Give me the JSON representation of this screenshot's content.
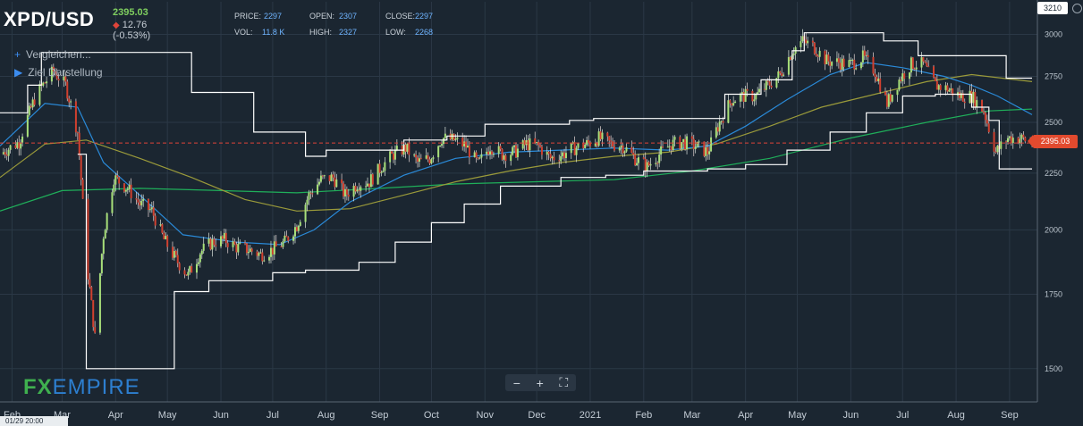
{
  "header": {
    "symbol": "XPD/USD",
    "last_price": "2395.03",
    "change": "12.76 (-0.53%)",
    "change_direction": "down"
  },
  "stats": {
    "price_label": "PRICE:",
    "price_value": "2297",
    "open_label": "OPEN:",
    "open_value": "2307",
    "close_label": "CLOSE:",
    "close_value": "2297",
    "vol_label": "VOL:",
    "vol_value": "11.8 K",
    "high_label": "HIGH:",
    "high_value": "2327",
    "low_label": "LOW:",
    "low_value": "2268"
  },
  "side_menu": {
    "compare_label": "Vergleichen...",
    "target_label": "Ziel Darstellung"
  },
  "logo": {
    "part1": "FX",
    "part2": "EMPIRE"
  },
  "zoom": {
    "minus": "−",
    "plus": "+",
    "fit": "⛶"
  },
  "axis_badges": {
    "top_value": "3210",
    "last_value": "2395.03"
  },
  "cursor": {
    "timestamp": "01/29 20:00"
  },
  "colors": {
    "background": "#1b2631",
    "up_candle": "#a8e07a",
    "down_candle": "#d0402f",
    "ma_fast": "#2a8ad8",
    "ma_slow": "#9a9a3a",
    "ma_long": "#1faf5a",
    "channel": "#ffffff",
    "last_line": "#e0443a"
  },
  "chart_data": {
    "type": "line",
    "title": "XPD/USD",
    "y_scale": "log",
    "ylim": [
      1400,
      3210
    ],
    "y_ticks": [
      1500,
      1750,
      2000,
      2250,
      2500,
      2750,
      3000
    ],
    "y_tick_labels": [
      "1500",
      "1750",
      "2000",
      "2250",
      "2500",
      "2750",
      "3000"
    ],
    "x_tick_labels": [
      "Feb",
      "Mar",
      "Apr",
      "May",
      "Jun",
      "Jul",
      "Aug",
      "Sep",
      "Oct",
      "Nov",
      "Dec",
      "2021",
      "Feb",
      "Mar",
      "Apr",
      "May",
      "Jun",
      "Jul",
      "Aug",
      "Sep"
    ],
    "x_tick_dates": [
      "2020-02-01",
      "2020-03-01",
      "2020-04-01",
      "2020-05-01",
      "2020-06-01",
      "2020-07-01",
      "2020-08-01",
      "2020-09-01",
      "2020-10-01",
      "2020-11-01",
      "2020-12-01",
      "2021-01-01",
      "2021-02-01",
      "2021-03-01",
      "2021-04-01",
      "2021-05-01",
      "2021-06-01",
      "2021-07-01",
      "2021-08-01",
      "2021-09-01"
    ],
    "x_range": [
      "2020-01-25",
      "2021-09-14"
    ],
    "grid": true,
    "last_value": 2395.03,
    "series": [
      {
        "kind": "price",
        "points": [
          [
            "2020-01-25",
            2340
          ],
          [
            "2020-02-05",
            2400
          ],
          [
            "2020-02-15",
            2650
          ],
          [
            "2020-02-25",
            2780
          ],
          [
            "2020-03-03",
            2700
          ],
          [
            "2020-03-10",
            2450
          ],
          [
            "2020-03-15",
            1880
          ],
          [
            "2020-03-20",
            1600
          ],
          [
            "2020-03-25",
            1980
          ],
          [
            "2020-03-31",
            2230
          ],
          [
            "2020-04-08",
            2180
          ],
          [
            "2020-04-15",
            2110
          ],
          [
            "2020-04-22",
            2080
          ],
          [
            "2020-04-29",
            1960
          ],
          [
            "2020-05-06",
            1880
          ],
          [
            "2020-05-13",
            1820
          ],
          [
            "2020-05-20",
            1910
          ],
          [
            "2020-05-27",
            1950
          ],
          [
            "2020-06-03",
            1960
          ],
          [
            "2020-06-10",
            1930
          ],
          [
            "2020-06-17",
            1920
          ],
          [
            "2020-06-24",
            1900
          ],
          [
            "2020-07-01",
            1920
          ],
          [
            "2020-07-08",
            1950
          ],
          [
            "2020-07-15",
            2020
          ],
          [
            "2020-07-22",
            2150
          ],
          [
            "2020-07-29",
            2220
          ],
          [
            "2020-08-05",
            2230
          ],
          [
            "2020-08-12",
            2150
          ],
          [
            "2020-08-19",
            2200
          ],
          [
            "2020-08-26",
            2210
          ],
          [
            "2020-09-02",
            2280
          ],
          [
            "2020-09-09",
            2340
          ],
          [
            "2020-09-16",
            2370
          ],
          [
            "2020-09-23",
            2300
          ],
          [
            "2020-09-30",
            2320
          ],
          [
            "2020-10-07",
            2420
          ],
          [
            "2020-10-14",
            2410
          ],
          [
            "2020-10-21",
            2380
          ],
          [
            "2020-10-28",
            2290
          ],
          [
            "2020-11-04",
            2380
          ],
          [
            "2020-11-11",
            2340
          ],
          [
            "2020-11-18",
            2350
          ],
          [
            "2020-11-25",
            2390
          ],
          [
            "2020-12-02",
            2380
          ],
          [
            "2020-12-09",
            2320
          ],
          [
            "2020-12-16",
            2340
          ],
          [
            "2020-12-23",
            2370
          ],
          [
            "2020-12-30",
            2390
          ],
          [
            "2021-01-06",
            2420
          ],
          [
            "2021-01-13",
            2390
          ],
          [
            "2021-01-20",
            2380
          ],
          [
            "2021-01-27",
            2320
          ],
          [
            "2021-02-03",
            2280
          ],
          [
            "2021-02-10",
            2340
          ],
          [
            "2021-02-17",
            2390
          ],
          [
            "2021-02-24",
            2400
          ],
          [
            "2021-03-03",
            2380
          ],
          [
            "2021-03-10",
            2350
          ],
          [
            "2021-03-17",
            2500
          ],
          [
            "2021-03-24",
            2620
          ],
          [
            "2021-03-31",
            2640
          ],
          [
            "2021-04-07",
            2640
          ],
          [
            "2021-04-14",
            2700
          ],
          [
            "2021-04-21",
            2760
          ],
          [
            "2021-04-28",
            2900
          ],
          [
            "2021-05-04",
            2960
          ],
          [
            "2021-05-11",
            2920
          ],
          [
            "2021-05-18",
            2840
          ],
          [
            "2021-05-25",
            2830
          ],
          [
            "2021-06-01",
            2820
          ],
          [
            "2021-06-08",
            2860
          ],
          [
            "2021-06-15",
            2780
          ],
          [
            "2021-06-22",
            2600
          ],
          [
            "2021-06-29",
            2730
          ],
          [
            "2021-07-06",
            2820
          ],
          [
            "2021-07-13",
            2820
          ],
          [
            "2021-07-20",
            2700
          ],
          [
            "2021-07-27",
            2680
          ],
          [
            "2021-08-03",
            2640
          ],
          [
            "2021-08-10",
            2640
          ],
          [
            "2021-08-17",
            2560
          ],
          [
            "2021-08-24",
            2350
          ],
          [
            "2021-08-31",
            2420
          ],
          [
            "2021-09-07",
            2420
          ],
          [
            "2021-09-14",
            2395
          ]
        ]
      },
      {
        "kind": "channel-upper",
        "points": [
          [
            "2020-01-25",
            2550
          ],
          [
            "2020-02-01",
            2550
          ],
          [
            "2020-02-10",
            2700
          ],
          [
            "2020-02-18",
            2890
          ],
          [
            "2020-04-25",
            2890
          ],
          [
            "2020-05-15",
            2660
          ],
          [
            "2020-06-20",
            2450
          ],
          [
            "2020-07-20",
            2330
          ],
          [
            "2020-08-01",
            2360
          ],
          [
            "2020-09-15",
            2410
          ],
          [
            "2020-10-10",
            2430
          ],
          [
            "2020-11-01",
            2490
          ],
          [
            "2020-12-20",
            2510
          ],
          [
            "2021-01-03",
            2520
          ],
          [
            "2021-03-10",
            2520
          ],
          [
            "2021-03-20",
            2650
          ],
          [
            "2021-04-10",
            2730
          ],
          [
            "2021-04-28",
            2900
          ],
          [
            "2021-05-05",
            3010
          ],
          [
            "2021-06-10",
            3010
          ],
          [
            "2021-06-20",
            2960
          ],
          [
            "2021-07-10",
            2870
          ],
          [
            "2021-08-20",
            2870
          ],
          [
            "2021-08-30",
            2740
          ],
          [
            "2021-09-14",
            2740
          ]
        ]
      },
      {
        "kind": "channel-lower",
        "points": [
          [
            "2020-03-10",
            2340
          ],
          [
            "2020-03-15",
            1500
          ],
          [
            "2020-04-30",
            1500
          ],
          [
            "2020-05-05",
            1760
          ],
          [
            "2020-05-25",
            1800
          ],
          [
            "2020-07-01",
            1830
          ],
          [
            "2020-07-20",
            1840
          ],
          [
            "2020-08-20",
            1870
          ],
          [
            "2020-09-10",
            1950
          ],
          [
            "2020-10-01",
            2030
          ],
          [
            "2020-10-20",
            2110
          ],
          [
            "2020-11-10",
            2190
          ],
          [
            "2020-12-15",
            2230
          ],
          [
            "2021-01-10",
            2240
          ],
          [
            "2021-02-01",
            2260
          ],
          [
            "2021-03-10",
            2270
          ],
          [
            "2021-04-01",
            2290
          ],
          [
            "2021-04-25",
            2360
          ],
          [
            "2021-05-20",
            2450
          ],
          [
            "2021-06-10",
            2550
          ],
          [
            "2021-07-01",
            2640
          ],
          [
            "2021-07-20",
            2650
          ],
          [
            "2021-08-10",
            2580
          ],
          [
            "2021-08-20",
            2510
          ],
          [
            "2021-08-26",
            2270
          ],
          [
            "2021-09-14",
            2270
          ]
        ]
      },
      {
        "kind": "ma-fast",
        "points": [
          [
            "2020-01-25",
            2380
          ],
          [
            "2020-02-20",
            2600
          ],
          [
            "2020-03-10",
            2580
          ],
          [
            "2020-03-25",
            2300
          ],
          [
            "2020-04-15",
            2150
          ],
          [
            "2020-05-10",
            1980
          ],
          [
            "2020-06-10",
            1950
          ],
          [
            "2020-07-05",
            1940
          ],
          [
            "2020-07-25",
            2000
          ],
          [
            "2020-08-15",
            2120
          ],
          [
            "2020-09-15",
            2240
          ],
          [
            "2020-10-15",
            2320
          ],
          [
            "2020-11-15",
            2350
          ],
          [
            "2020-12-15",
            2360
          ],
          [
            "2021-01-15",
            2370
          ],
          [
            "2021-02-15",
            2360
          ],
          [
            "2021-03-10",
            2380
          ],
          [
            "2021-04-01",
            2480
          ],
          [
            "2021-04-25",
            2620
          ],
          [
            "2021-05-20",
            2760
          ],
          [
            "2021-06-10",
            2830
          ],
          [
            "2021-07-01",
            2800
          ],
          [
            "2021-07-25",
            2750
          ],
          [
            "2021-08-10",
            2700
          ],
          [
            "2021-08-25",
            2640
          ],
          [
            "2021-09-14",
            2540
          ]
        ]
      },
      {
        "kind": "ma-slow",
        "points": [
          [
            "2020-01-25",
            2230
          ],
          [
            "2020-02-20",
            2390
          ],
          [
            "2020-03-15",
            2410
          ],
          [
            "2020-04-15",
            2320
          ],
          [
            "2020-05-15",
            2230
          ],
          [
            "2020-06-15",
            2130
          ],
          [
            "2020-07-15",
            2080
          ],
          [
            "2020-08-15",
            2090
          ],
          [
            "2020-09-15",
            2150
          ],
          [
            "2020-10-15",
            2210
          ],
          [
            "2020-11-15",
            2260
          ],
          [
            "2020-12-15",
            2300
          ],
          [
            "2021-01-15",
            2330
          ],
          [
            "2021-02-15",
            2350
          ],
          [
            "2021-03-15",
            2390
          ],
          [
            "2021-04-15",
            2480
          ],
          [
            "2021-05-15",
            2580
          ],
          [
            "2021-06-15",
            2650
          ],
          [
            "2021-07-15",
            2720
          ],
          [
            "2021-08-10",
            2760
          ],
          [
            "2021-09-14",
            2720
          ]
        ]
      },
      {
        "kind": "ma-long",
        "points": [
          [
            "2020-01-25",
            2080
          ],
          [
            "2020-03-01",
            2170
          ],
          [
            "2020-04-15",
            2180
          ],
          [
            "2020-06-01",
            2170
          ],
          [
            "2020-07-15",
            2160
          ],
          [
            "2020-09-01",
            2180
          ],
          [
            "2020-10-15",
            2200
          ],
          [
            "2020-12-01",
            2210
          ],
          [
            "2021-01-15",
            2220
          ],
          [
            "2021-03-01",
            2260
          ],
          [
            "2021-04-15",
            2320
          ],
          [
            "2021-06-01",
            2420
          ],
          [
            "2021-07-15",
            2500
          ],
          [
            "2021-08-20",
            2560
          ],
          [
            "2021-09-14",
            2570
          ]
        ]
      }
    ]
  }
}
